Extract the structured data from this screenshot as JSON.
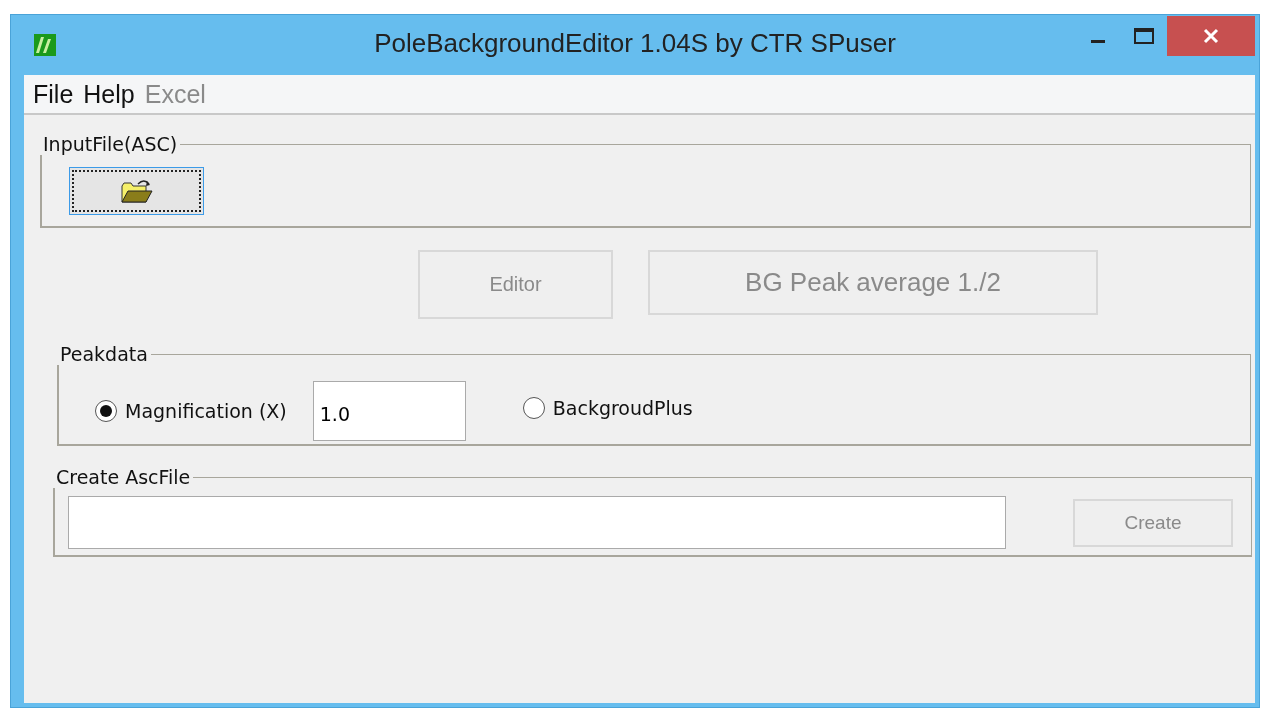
{
  "window": {
    "title": "PoleBackgroundEditor 1.04S by CTR SPuser"
  },
  "menu": [
    {
      "label": "File",
      "disabled": false
    },
    {
      "label": "Help",
      "disabled": false
    },
    {
      "label": "Excel",
      "disabled": true
    }
  ],
  "input_file": {
    "title": "InputFile(ASC)"
  },
  "actions": [
    {
      "label": "Editor",
      "disabled": true
    },
    {
      "label": "BG Peak average 1./2",
      "disabled": true
    }
  ],
  "peakdata": {
    "title": "Peakdata",
    "options": [
      {
        "label": "Magnification (X)",
        "selected": true
      },
      {
        "label": "BackgroudPlus",
        "selected": false
      }
    ],
    "magnification": "1.0"
  },
  "create": {
    "title": "Create AscFile",
    "button": {
      "label": "Create",
      "disabled": true
    }
  }
}
